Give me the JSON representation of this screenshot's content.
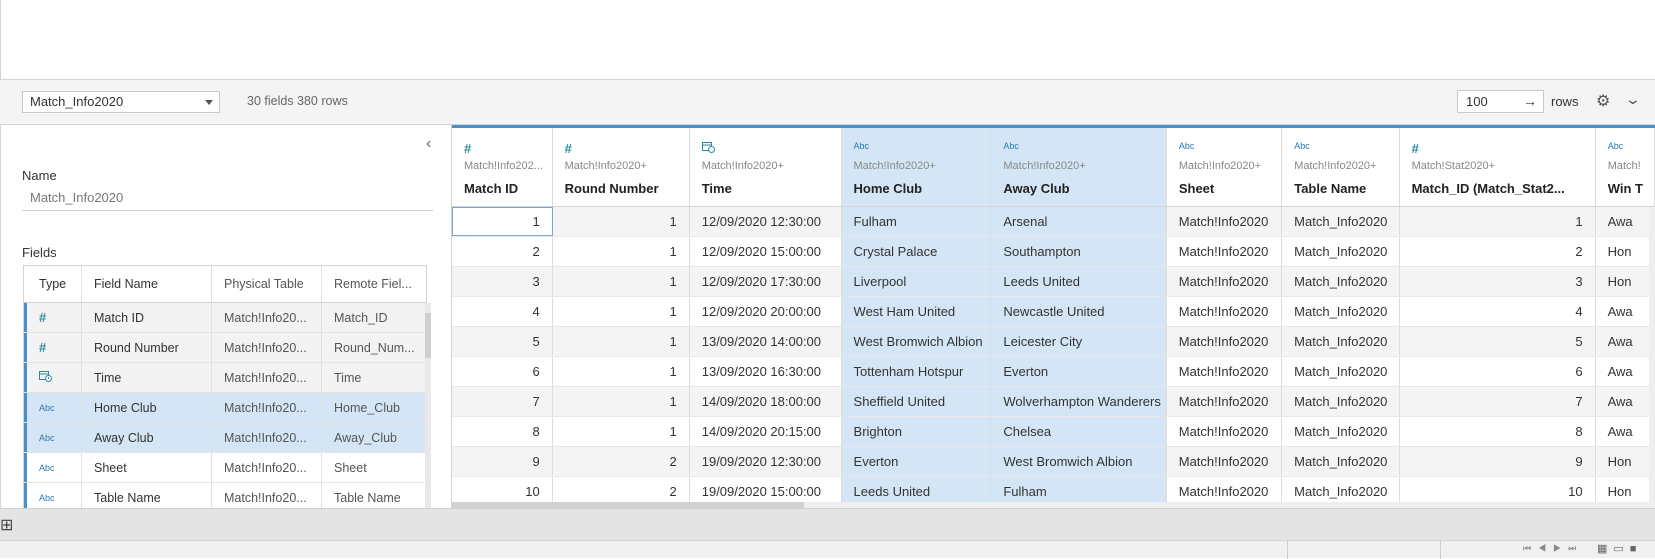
{
  "toolbar": {
    "table_select": "Match_Info2020",
    "summary": "30 fields 380 rows",
    "rows_value": "100",
    "rows_arrow": "→",
    "rows_label": "rows",
    "gear_glyph": "⚙",
    "chevron_glyph": "⌄"
  },
  "left_panel": {
    "collapse_glyph": "‹",
    "name_label": "Name",
    "name_value": "Match_Info2020",
    "fields_label": "Fields",
    "columns": [
      "Type",
      "Field Name",
      "Physical Table",
      "Remote Fiel..."
    ],
    "rows": [
      {
        "type_icon": "#",
        "type": "number",
        "name": "Match ID",
        "table": "Match!Info20...",
        "remote": "Match_ID"
      },
      {
        "type_icon": "#",
        "type": "number",
        "name": "Round Number",
        "table": "Match!Info20...",
        "remote": "Round_Num..."
      },
      {
        "type_icon": "📅",
        "type": "datetime",
        "name": "Time",
        "table": "Match!Info20...",
        "remote": "Time"
      },
      {
        "type_icon": "Abc",
        "type": "string",
        "name": "Home Club",
        "table": "Match!Info20...",
        "remote": "Home_Club"
      },
      {
        "type_icon": "Abc",
        "type": "string",
        "name": "Away Club",
        "table": "Match!Info20...",
        "remote": "Away_Club"
      },
      {
        "type_icon": "Abc",
        "type": "string",
        "name": "Sheet",
        "table": "Match!Info20...",
        "remote": "Sheet"
      },
      {
        "type_icon": "Abc",
        "type": "string",
        "name": "Table Name",
        "table": "Match!Info20...",
        "remote": "Table Name"
      }
    ]
  },
  "grid": {
    "columns": [
      {
        "icon": "#",
        "source": "Match!Info202...",
        "name": "Match ID"
      },
      {
        "icon": "#",
        "source": "Match!Info2020+",
        "name": "Round Number"
      },
      {
        "icon": "📅",
        "source": "Match!Info2020+",
        "name": "Time"
      },
      {
        "icon": "Abc",
        "source": "Match!Info2020+",
        "name": "Home Club"
      },
      {
        "icon": "Abc",
        "source": "Match!Info2020+",
        "name": "Away Club"
      },
      {
        "icon": "Abc",
        "source": "Match!Info2020+",
        "name": "Sheet"
      },
      {
        "icon": "Abc",
        "source": "Match!Info2020+",
        "name": "Table Name"
      },
      {
        "icon": "#",
        "source": "Match!Stat2020+",
        "name": "Match_ID (Match_Stat2..."
      },
      {
        "icon": "Abc",
        "source": "Match!",
        "name": "Win T"
      }
    ],
    "rows": [
      [
        "1",
        "1",
        "12/09/2020 12:30:00",
        "Fulham",
        "Arsenal",
        "Match!Info2020",
        "Match_Info2020",
        "1",
        "Awa"
      ],
      [
        "2",
        "1",
        "12/09/2020 15:00:00",
        "Crystal Palace",
        "Southampton",
        "Match!Info2020",
        "Match_Info2020",
        "2",
        "Hon"
      ],
      [
        "3",
        "1",
        "12/09/2020 17:30:00",
        "Liverpool",
        "Leeds United",
        "Match!Info2020",
        "Match_Info2020",
        "3",
        "Hon"
      ],
      [
        "4",
        "1",
        "12/09/2020 20:00:00",
        "West Ham United",
        "Newcastle United",
        "Match!Info2020",
        "Match_Info2020",
        "4",
        "Awa"
      ],
      [
        "5",
        "1",
        "13/09/2020 14:00:00",
        "West Bromwich Albion",
        "Leicester City",
        "Match!Info2020",
        "Match_Info2020",
        "5",
        "Awa"
      ],
      [
        "6",
        "1",
        "13/09/2020 16:30:00",
        "Tottenham Hotspur",
        "Everton",
        "Match!Info2020",
        "Match_Info2020",
        "6",
        "Awa"
      ],
      [
        "7",
        "1",
        "14/09/2020 18:00:00",
        "Sheffield United",
        "Wolverhampton Wanderers",
        "Match!Info2020",
        "Match_Info2020",
        "7",
        "Awa"
      ],
      [
        "8",
        "1",
        "14/09/2020 20:15:00",
        "Brighton",
        "Chelsea",
        "Match!Info2020",
        "Match_Info2020",
        "8",
        "Awa"
      ],
      [
        "9",
        "2",
        "19/09/2020 12:30:00",
        "Everton",
        "West Bromwich Albion",
        "Match!Info2020",
        "Match_Info2020",
        "9",
        "Hon"
      ],
      [
        "10",
        "2",
        "19/09/2020 15:00:00",
        "Leeds United",
        "Fulham",
        "Match!Info2020",
        "Match_Info2020",
        "10",
        "Hon"
      ]
    ]
  },
  "bottom": {
    "new_sheet_glyph": "⊞",
    "nav_glyphs": "⏮◀▶⏭",
    "view_glyphs": "▦▭■"
  },
  "colors": {
    "accent": "#4a90c8",
    "selection": "#d4e6f5",
    "hash_icon": "#2b8a9e",
    "abc_icon": "#2b78b0"
  }
}
